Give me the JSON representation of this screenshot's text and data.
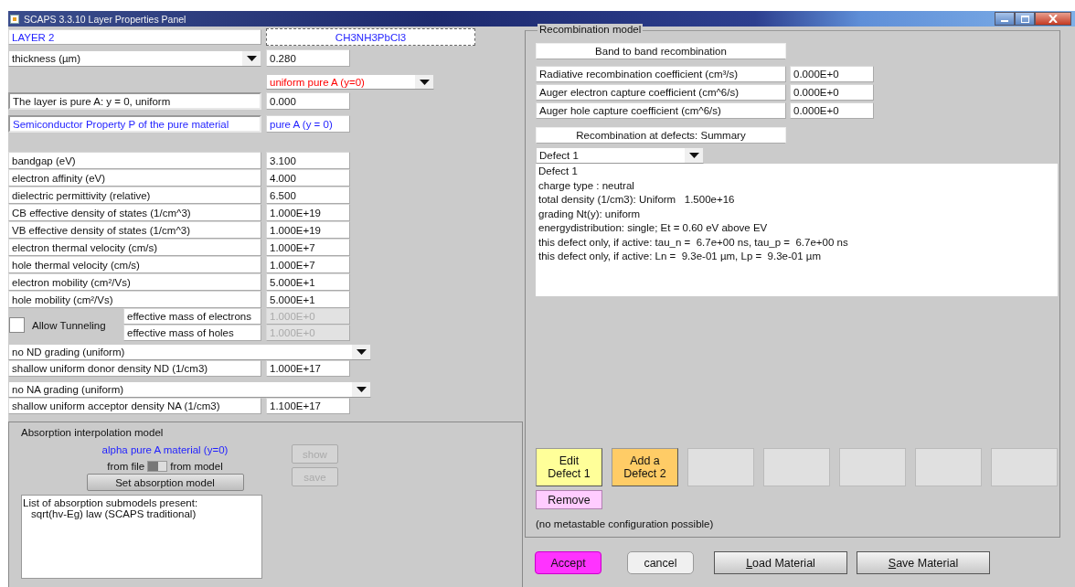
{
  "window": {
    "title": "SCAPS 3.3.10 Layer Properties Panel"
  },
  "layer": {
    "name": "LAYER 2",
    "material": "CH3NH3PbCl3"
  },
  "thickness": {
    "label": "thickness (µm)",
    "value": "0.280"
  },
  "composition": {
    "grading": "uniform pure A (y=0)",
    "description": "The layer is pure A: y = 0, uniform",
    "y_value": "0.000",
    "property_label": "Semiconductor Property P of the pure material",
    "property_value": "pure A (y = 0)"
  },
  "properties": [
    {
      "label": "bandgap (eV)",
      "value": "3.100"
    },
    {
      "label": "electron affinity (eV)",
      "value": "4.000"
    },
    {
      "label": "dielectric permittivity (relative)",
      "value": "6.500"
    },
    {
      "label": "CB effective density of states (1/cm^3)",
      "value": "1.000E+19"
    },
    {
      "label": "VB effective density of states (1/cm^3)",
      "value": "1.000E+19"
    },
    {
      "label": "electron thermal velocity (cm/s)",
      "value": "1.000E+7"
    },
    {
      "label": "hole thermal velocity (cm/s)",
      "value": "1.000E+7"
    },
    {
      "label": "electron mobility (cm²/Vs)",
      "value": "5.000E+1"
    },
    {
      "label": "hole mobility (cm²/Vs)",
      "value": "5.000E+1"
    }
  ],
  "tunneling": {
    "label": "Allow Tunneling",
    "checked": false,
    "masses": [
      {
        "label": "effective mass of electrons",
        "value": "1.000E+0",
        "disabled": true
      },
      {
        "label": "effective mass of holes",
        "value": "1.000E+0",
        "disabled": true
      }
    ]
  },
  "doping": [
    {
      "grading": "no ND grading (uniform)",
      "label": "shallow uniform donor density ND (1/cm3)",
      "value": "1.000E+17"
    },
    {
      "grading": "no NA grading (uniform)",
      "label": "shallow uniform acceptor density NA (1/cm3)",
      "value": "1.100E+17"
    }
  ],
  "absorption": {
    "title": "Absorption interpolation model",
    "subtitle": "alpha pure A material (y=0)",
    "from_file": "from file",
    "from_model": "from model",
    "from_model_selected": false,
    "set_button": "Set absorption model",
    "show_button": {
      "label": "show",
      "disabled": true
    },
    "save_button": {
      "label": "save",
      "disabled": true
    },
    "submodels": [
      "List of absorption submodels present:",
      "sqrt(hv-Eg) law (SCAPS traditional)"
    ]
  },
  "recombination": {
    "title": "Recombination model",
    "band_header": "Band to band recombination",
    "coefficients": [
      {
        "label": "Radiative recombination coefficient (cm³/s)",
        "value": "0.000E+0"
      },
      {
        "label": "Auger electron capture coefficient (cm^6/s)",
        "value": "0.000E+0"
      },
      {
        "label": "Auger hole capture coefficient (cm^6/s)",
        "value": "0.000E+0"
      }
    ],
    "defects_header": "Recombination at defects: Summary",
    "defect_select": "Defect 1",
    "summary": [
      "Defect 1",
      "charge type : neutral",
      "total density (1/cm3): Uniform   1.500e+16",
      "grading Nt(y): uniform",
      "energydistribution: single; Et = 0.60 eV above EV",
      "this defect only, if active: tau_n =  6.7e+00 ns, tau_p =  6.7e+00 ns",
      "this defect only, if active: Ln =  9.3e-01 µm, Lp =  9.3e-01 µm"
    ],
    "defect_buttons": [
      {
        "kind": "edit",
        "lines": [
          "Edit",
          "Defect 1"
        ]
      },
      {
        "kind": "add",
        "lines": [
          "Add a",
          "Defect 2"
        ]
      },
      {
        "kind": "empty"
      },
      {
        "kind": "empty"
      },
      {
        "kind": "empty"
      },
      {
        "kind": "empty"
      },
      {
        "kind": "empty"
      }
    ],
    "remove": "Remove",
    "note": "(no metastable configuration possible)"
  },
  "actions": [
    {
      "kind": "accept",
      "label": "Accept"
    },
    {
      "kind": "cancel",
      "label": "cancel"
    },
    {
      "kind": "material",
      "mnemonic": "L",
      "label_rest": "oad Material"
    },
    {
      "kind": "material",
      "mnemonic": "S",
      "label_rest": "ave Material"
    }
  ]
}
